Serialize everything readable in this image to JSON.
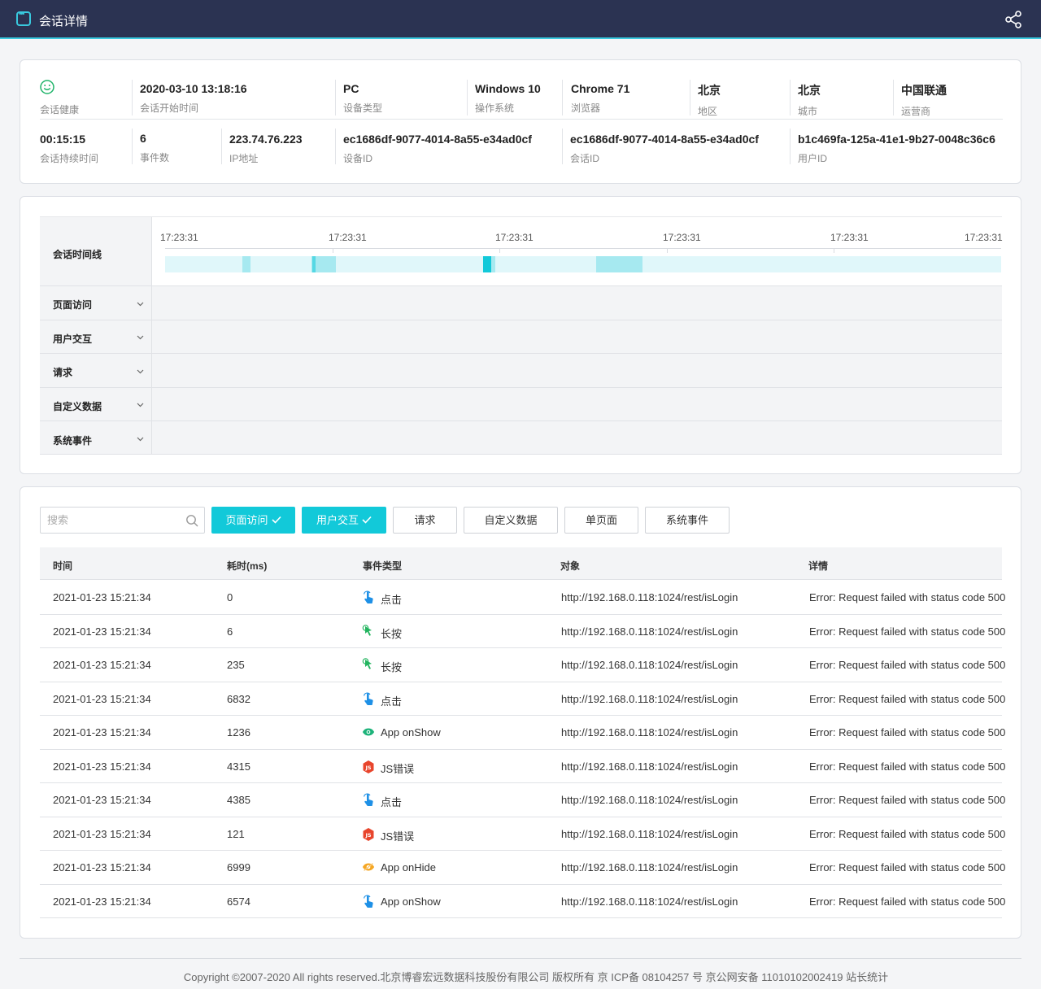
{
  "header": {
    "title": "会话详情",
    "icon": "chat-bubble-icon",
    "share_icon": "share-icon"
  },
  "info": {
    "row1": [
      {
        "value": "",
        "label": "会话健康",
        "icon": "smile-icon"
      },
      {
        "value": "2020-03-10 13:18:16",
        "label": "会话开始时间"
      },
      {
        "value": "PC",
        "label": "设备类型"
      },
      {
        "value": "Windows 10",
        "label": "操作系统"
      },
      {
        "value": "Chrome 71",
        "label": "浏览器"
      },
      {
        "value": "北京",
        "label": "地区"
      },
      {
        "value": "北京",
        "label": "城市"
      },
      {
        "value": "中国联通",
        "label": "运营商"
      }
    ],
    "row2": [
      {
        "value": "00:15:15",
        "label": "会话持续时间"
      },
      {
        "value": "6",
        "label": "事件数"
      },
      {
        "value": "223.74.76.223",
        "label": "IP地址"
      },
      {
        "value": "ec1686df-9077-4014-8a55-e34ad0cf",
        "label": "设备ID"
      },
      {
        "value": "ec1686df-9077-4014-8a55-e34ad0cf",
        "label": "会话ID"
      },
      {
        "value": "b1c469fa-125a-41e1-9b27-0048c36c6",
        "label": "用户ID"
      }
    ]
  },
  "timeline": {
    "title": "会话时间线",
    "ticks": [
      "17:23:31",
      "17:23:31",
      "17:23:31",
      "17:23:31",
      "17:23:31",
      "17:23:31"
    ],
    "rows": [
      "页面访问",
      "用户交互",
      "请求",
      "自定义数据",
      "系统事件"
    ],
    "colors": {
      "track": "#e0f7fa",
      "light": "#a6e9f0",
      "dark": "#12c9d9"
    }
  },
  "events": {
    "search_placeholder": "搜索",
    "filters": [
      {
        "label": "页面访问",
        "active": true
      },
      {
        "label": "用户交互",
        "active": true
      },
      {
        "label": "请求",
        "active": false
      },
      {
        "label": "自定义数据",
        "active": false
      },
      {
        "label": "单页面",
        "active": false
      },
      {
        "label": "系统事件",
        "active": false
      }
    ],
    "columns": [
      "时间",
      "耗时(ms)",
      "事件类型",
      "对象",
      "详情"
    ],
    "rows": [
      {
        "time": "2021-01-23  15:21:34",
        "duration": "0",
        "type": "点击",
        "icon": "tap-icon",
        "target": "http://192.168.0.118:1024/rest/isLogin",
        "detail": "Error: Request failed with status code 500"
      },
      {
        "time": "2021-01-23  15:21:34",
        "duration": "6",
        "type": "长按",
        "icon": "long-press-icon",
        "target": "http://192.168.0.118:1024/rest/isLogin",
        "detail": "Error: Request failed with status code 500"
      },
      {
        "time": "2021-01-23  15:21:34",
        "duration": "235",
        "type": "长按",
        "icon": "long-press-icon",
        "target": "http://192.168.0.118:1024/rest/isLogin",
        "detail": "Error: Request failed with status code 500"
      },
      {
        "time": "2021-01-23  15:21:34",
        "duration": "6832",
        "type": "点击",
        "icon": "tap-icon",
        "target": "http://192.168.0.118:1024/rest/isLogin",
        "detail": "Error: Request failed with status code 500"
      },
      {
        "time": "2021-01-23  15:21:34",
        "duration": "1236",
        "type": "App onShow",
        "icon": "eye-icon",
        "target": "http://192.168.0.118:1024/rest/isLogin",
        "detail": "Error: Request failed with status code 500"
      },
      {
        "time": "2021-01-23  15:21:34",
        "duration": "4315",
        "type": "JS错误",
        "icon": "js-error-icon",
        "target": "http://192.168.0.118:1024/rest/isLogin",
        "detail": "Error: Request failed with status code 500"
      },
      {
        "time": "2021-01-23  15:21:34",
        "duration": "4385",
        "type": "点击",
        "icon": "tap-icon",
        "target": "http://192.168.0.118:1024/rest/isLogin",
        "detail": "Error: Request failed with status code 500"
      },
      {
        "time": "2021-01-23  15:21:34",
        "duration": "121",
        "type": "JS错误",
        "icon": "js-error-icon",
        "target": "http://192.168.0.118:1024/rest/isLogin",
        "detail": "Error: Request failed with status code 500"
      },
      {
        "time": "2021-01-23  15:21:34",
        "duration": "6999",
        "type": "App onHide",
        "icon": "eye-off-icon",
        "target": "http://192.168.0.118:1024/rest/isLogin",
        "detail": "Error: Request failed with status code 500"
      },
      {
        "time": "2021-01-23  15:21:34",
        "duration": "6574",
        "type": "App onShow",
        "icon": "tap-icon",
        "target": "http://192.168.0.118:1024/rest/isLogin",
        "detail": "Error: Request failed with status code 500"
      }
    ]
  },
  "footer": {
    "copyright": "Copyright ©2007-2020 All rights reserved.北京博睿宏远数据科技股份有限公司 版权所有 京 ICP备 08104257 号 京公网安备 11010102002419 站长统计"
  }
}
